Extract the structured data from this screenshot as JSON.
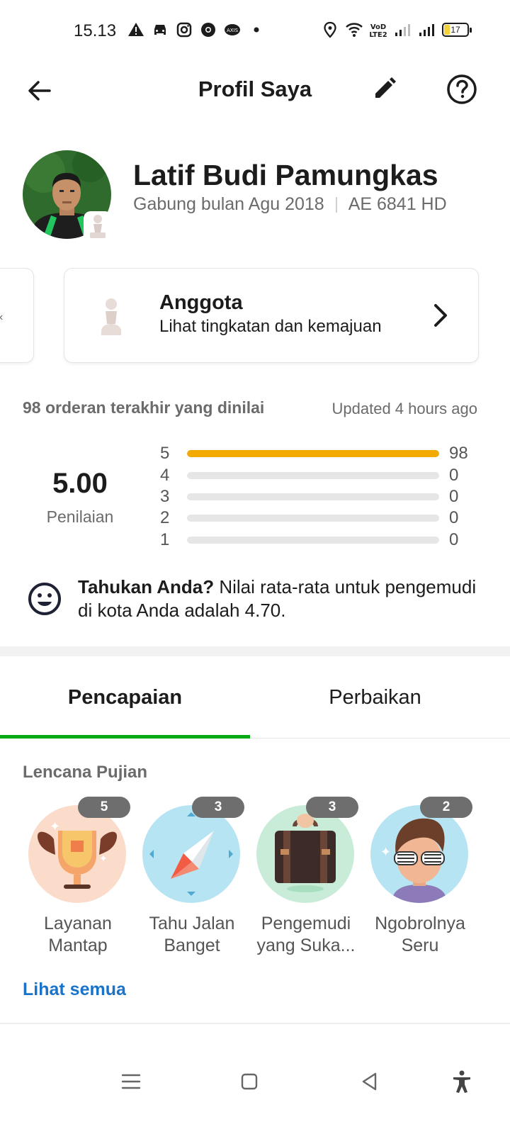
{
  "status_bar": {
    "time": "15.13",
    "battery": "17"
  },
  "header": {
    "title": "Profil Saya"
  },
  "profile": {
    "name": "Latif Budi Pamungkas",
    "joined": "Gabung bulan Agu 2018",
    "plate": "AE 6841 HD"
  },
  "tier_card": {
    "title": "Anggota",
    "subtitle": "Lihat tingkatan dan kemajuan"
  },
  "ratings": {
    "heading": "98 orderan terakhir yang dinilai",
    "updated": "Updated 4 hours ago",
    "score": "5.00",
    "score_label": "Penilaian",
    "bars": [
      {
        "star": "5",
        "count": "98",
        "fraction": 1.0
      },
      {
        "star": "4",
        "count": "0",
        "fraction": 0
      },
      {
        "star": "3",
        "count": "0",
        "fraction": 0
      },
      {
        "star": "2",
        "count": "0",
        "fraction": 0
      },
      {
        "star": "1",
        "count": "0",
        "fraction": 0
      }
    ],
    "bar_color": "#f2a900"
  },
  "info": {
    "bold": "Tahukan Anda?",
    "text": " Nilai rata-rata untuk pengemudi di kota Anda adalah 4.70."
  },
  "tabs": {
    "achievements": "Pencapaian",
    "improvements": "Perbaikan",
    "active_color": "#00aa13"
  },
  "badges": {
    "title": "Lencana Pujian",
    "items": [
      {
        "count": "5",
        "label": "Layanan Mantap",
        "icon": "trophy-icon"
      },
      {
        "count": "3",
        "label": "Tahu Jalan Banget",
        "icon": "compass-icon"
      },
      {
        "count": "3",
        "label": "Pengemudi yang Suka...",
        "icon": "suitcase-icon"
      },
      {
        "count": "2",
        "label": "Ngobrolnya Seru",
        "icon": "cool-person-icon"
      }
    ],
    "see_all": "Lihat semua"
  }
}
